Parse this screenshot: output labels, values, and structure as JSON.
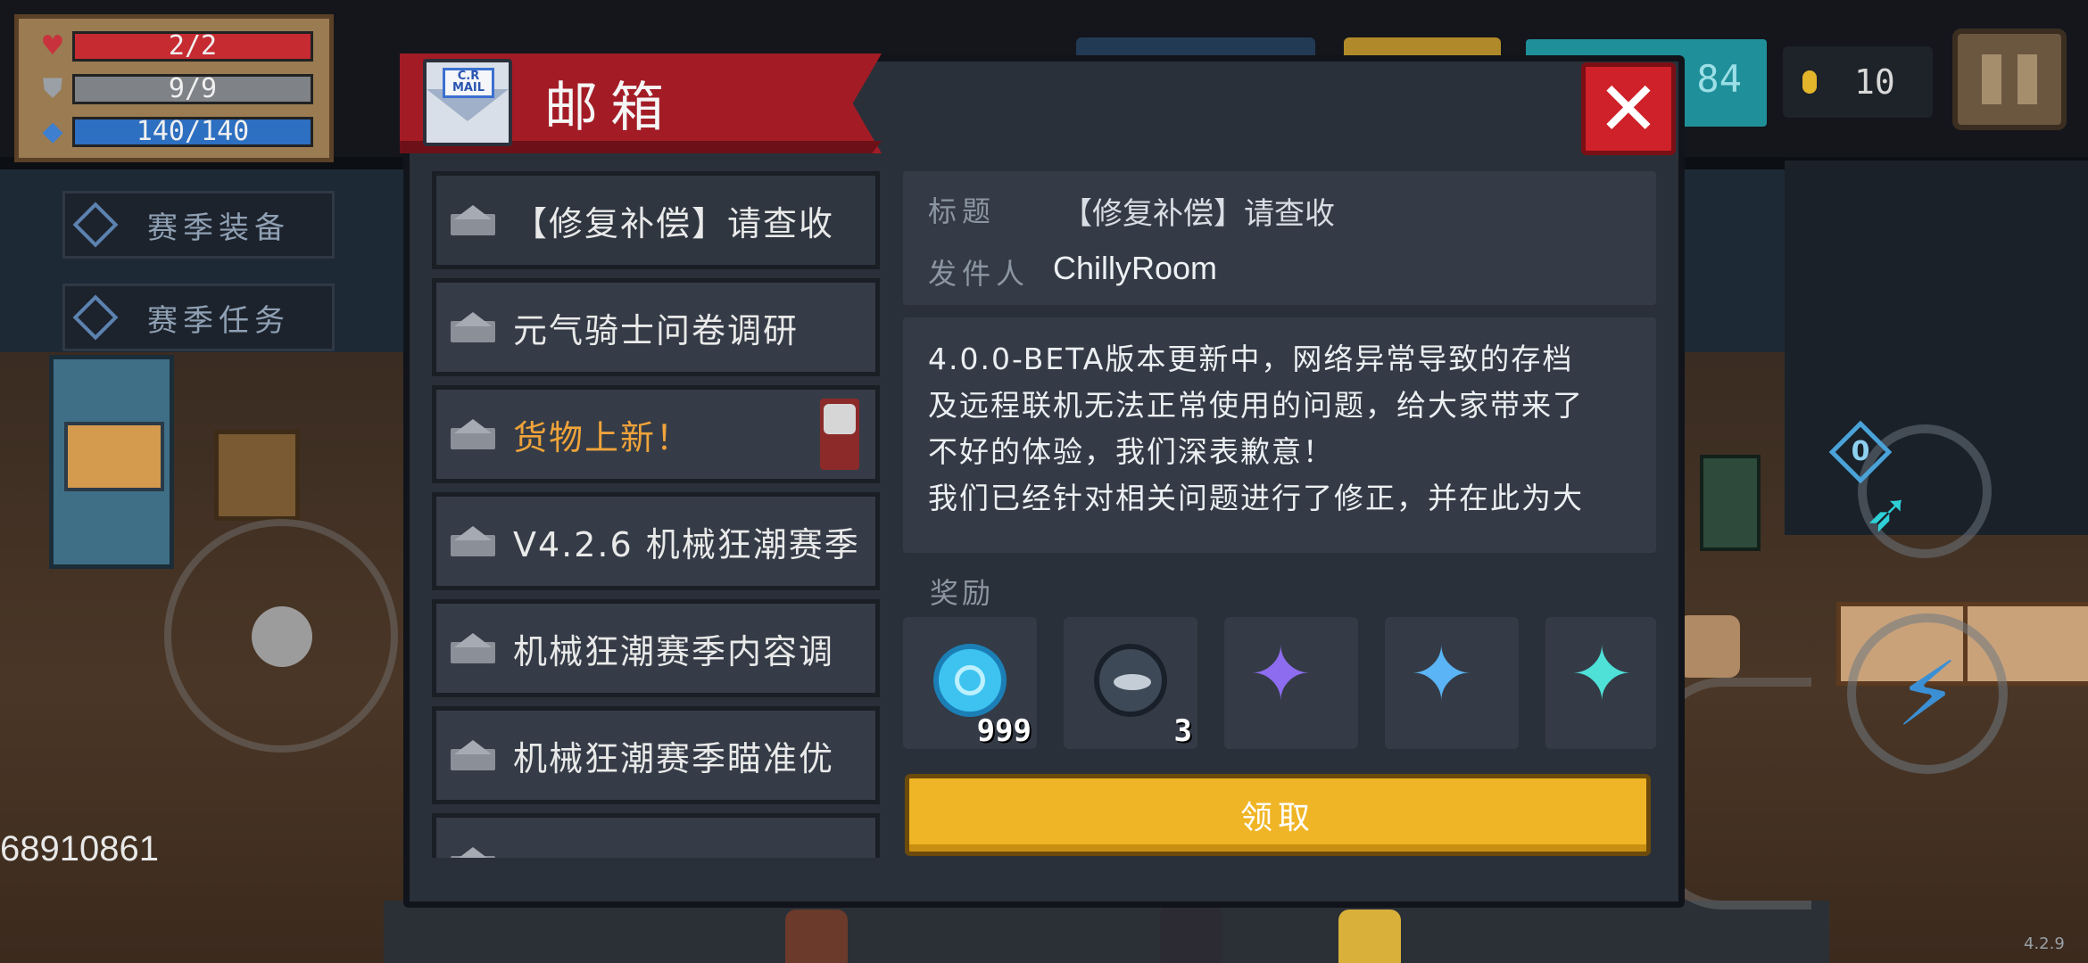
{
  "hud": {
    "hp": "2/2",
    "armor": "9/9",
    "energy": "140/140",
    "hp_fill": 1.0,
    "armor_fill": 1.0,
    "energy_fill": 1.0,
    "side_buttons": [
      "赛季装备",
      "赛季任务"
    ],
    "gems_partial": "84",
    "coins": "10",
    "player_id": "68910861",
    "weapon_badge": "0",
    "version": "4.2.9"
  },
  "mail": {
    "title": "邮箱",
    "icon_tag": "C.R MAIL",
    "list": [
      {
        "subject": "【修复补偿】请查收",
        "highlight": false
      },
      {
        "subject": "元气骑士问卷调研",
        "highlight": false
      },
      {
        "subject": "货物上新！",
        "highlight": true
      },
      {
        "subject": "V4.2.6 机械狂潮赛季",
        "highlight": false
      },
      {
        "subject": "机械狂潮赛季内容调",
        "highlight": false
      },
      {
        "subject": "机械狂潮赛季瞄准优",
        "highlight": false
      }
    ],
    "detail": {
      "title_label": "标题",
      "title_value": "【修复补偿】请查收",
      "sender_label": "发件人",
      "sender_value": "ChillyRoom",
      "body_lines": [
        "4.0.0-BETA版本更新中，网络异常导致的存档",
        "及远程联机无法正常使用的问题，给大家带来了",
        "不好的体验，我们深表歉意！",
        "我们已经针对相关问题进行了修正，并在此为大"
      ],
      "reward_label": "奖励",
      "rewards": [
        {
          "icon": "blue-gem-orb-icon",
          "qty": "999"
        },
        {
          "icon": "fish-coin-icon",
          "qty": "3"
        },
        {
          "icon": "purple-crystal-icon",
          "qty": ""
        },
        {
          "icon": "blue-crystal-icon",
          "qty": ""
        },
        {
          "icon": "cyan-crystal-icon",
          "qty": ""
        }
      ],
      "claim_label": "领取"
    }
  },
  "colors": {
    "banner": "#a31c25",
    "close": "#cf2129",
    "claim": "#f0b526",
    "highlight_text": "#f0a33a"
  }
}
